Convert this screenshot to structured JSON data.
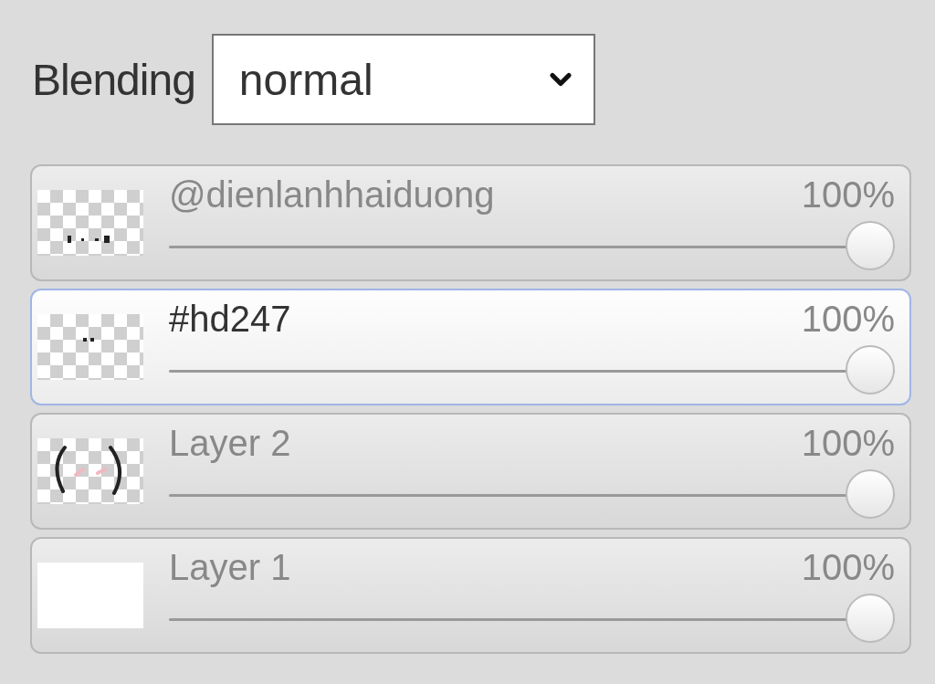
{
  "blending": {
    "label": "Blending",
    "value": "normal"
  },
  "layers": [
    {
      "name": "@dienlanhhaiduong",
      "opacity": "100%",
      "level": 1,
      "selected": false,
      "kind": "marks"
    },
    {
      "name": "#hd247",
      "opacity": "100%",
      "level": 1,
      "selected": true,
      "kind": "dots"
    },
    {
      "name": "Layer 2",
      "opacity": "100%",
      "level": 1,
      "selected": false,
      "kind": "brackets"
    },
    {
      "name": "Layer 1",
      "opacity": "100%",
      "level": 1,
      "selected": false,
      "kind": "white"
    }
  ]
}
